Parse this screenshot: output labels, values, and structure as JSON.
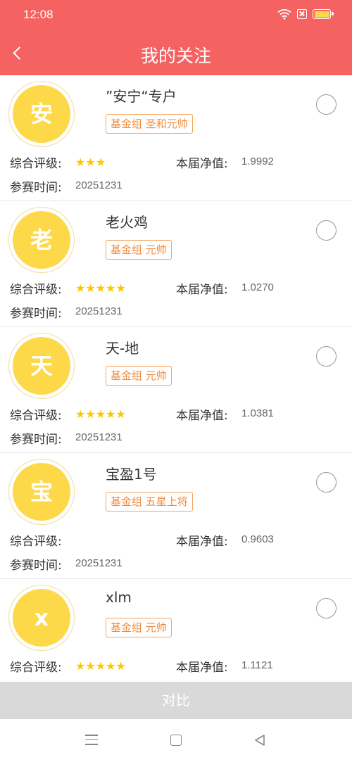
{
  "status_bar": {
    "time": "12:08"
  },
  "header": {
    "title": "我的关注"
  },
  "labels": {
    "rating": "综合评级:",
    "net_value": "本届净值:",
    "entry_time": "参赛时间:"
  },
  "items": [
    {
      "avatar_char": "安",
      "name": "”安宁“专户",
      "tag": "基金组 圣和元帅",
      "stars": "★★★",
      "net_value": "1.9992",
      "entry_time": "20251231"
    },
    {
      "avatar_char": "老",
      "name": "老火鸡",
      "tag": "基金组 元帅",
      "stars": "★★★★★",
      "net_value": "1.0270",
      "entry_time": "20251231"
    },
    {
      "avatar_char": "天",
      "name": "天-地",
      "tag": "基金组 元帅",
      "stars": "★★★★★",
      "net_value": "1.0381",
      "entry_time": "20251231"
    },
    {
      "avatar_char": "宝",
      "name": "宝盈1号",
      "tag": "基金组 五星上将",
      "stars": "",
      "net_value": "0.9603",
      "entry_time": "20251231"
    },
    {
      "avatar_char": "x",
      "name": "xlm",
      "tag": "基金组 元帅",
      "stars": "★★★★★",
      "net_value": "1.1121",
      "entry_time": ""
    }
  ],
  "footer": {
    "compare_label": "对比"
  },
  "colors": {
    "header_bg": "#f56262",
    "avatar_bg": "#fdd848",
    "tag_color": "#f08a3c",
    "star_color": "#fcc700"
  },
  "icons": [
    "back-arrow-icon",
    "wifi-icon",
    "sim-x-icon",
    "battery-icon",
    "menu-icon",
    "home-icon",
    "back-triangle-icon"
  ]
}
